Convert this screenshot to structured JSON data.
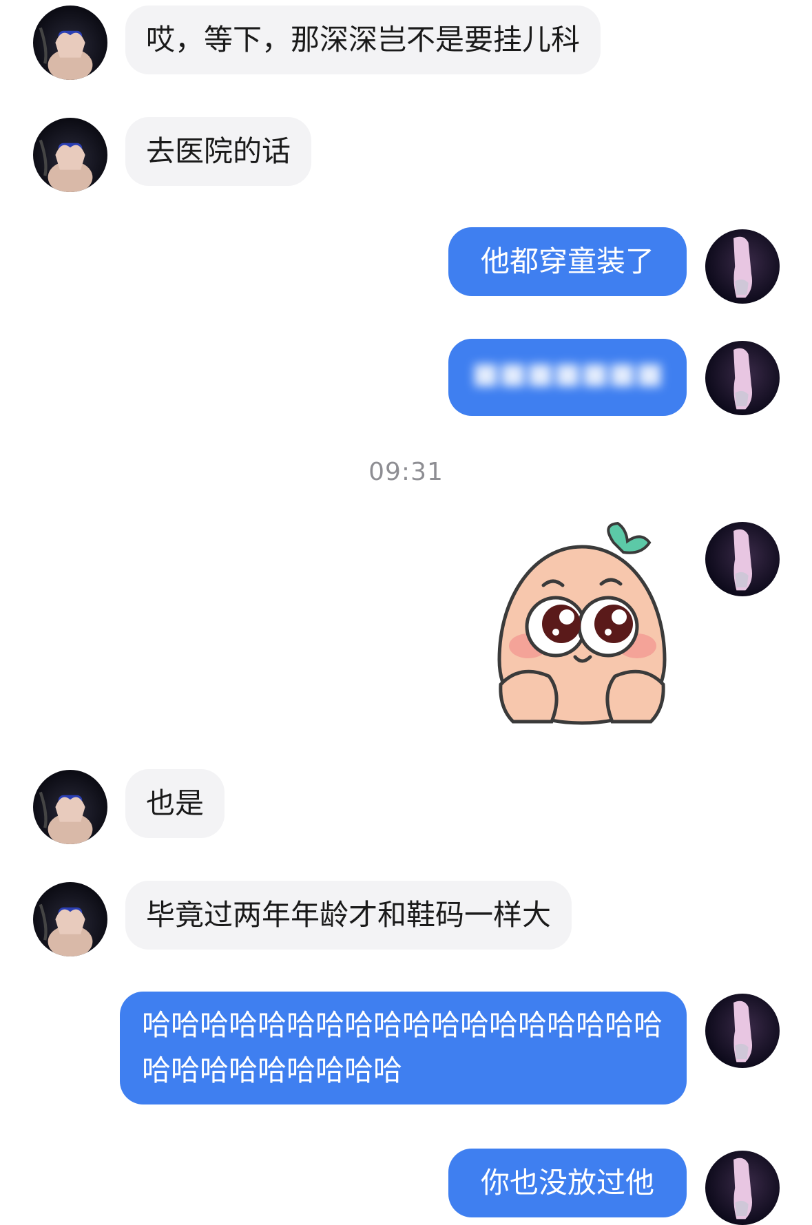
{
  "timestamp": "09:31",
  "messages": {
    "m1": "哎，等下，那深深岂不是要挂儿科",
    "m2": "去医院的话",
    "m3": "他都穿童装了",
    "m4": "■■■■■■■",
    "m5": "也是",
    "m6": "毕竟过两年年龄才和鞋码一样大",
    "m7": "哈哈哈哈哈哈哈哈哈哈哈哈哈哈哈哈哈哈哈哈哈哈哈哈哈哈哈",
    "m8": "你也没放过他"
  },
  "icons": {
    "left_avatar": "avatar-hands-heart-icon",
    "right_avatar": "avatar-pink-figure-icon",
    "sticker": "peach-face-sticker"
  },
  "colors": {
    "outgoing_bubble": "#3f7ff0",
    "incoming_bubble": "#f3f3f5",
    "timestamp_text": "#8e8e93"
  }
}
